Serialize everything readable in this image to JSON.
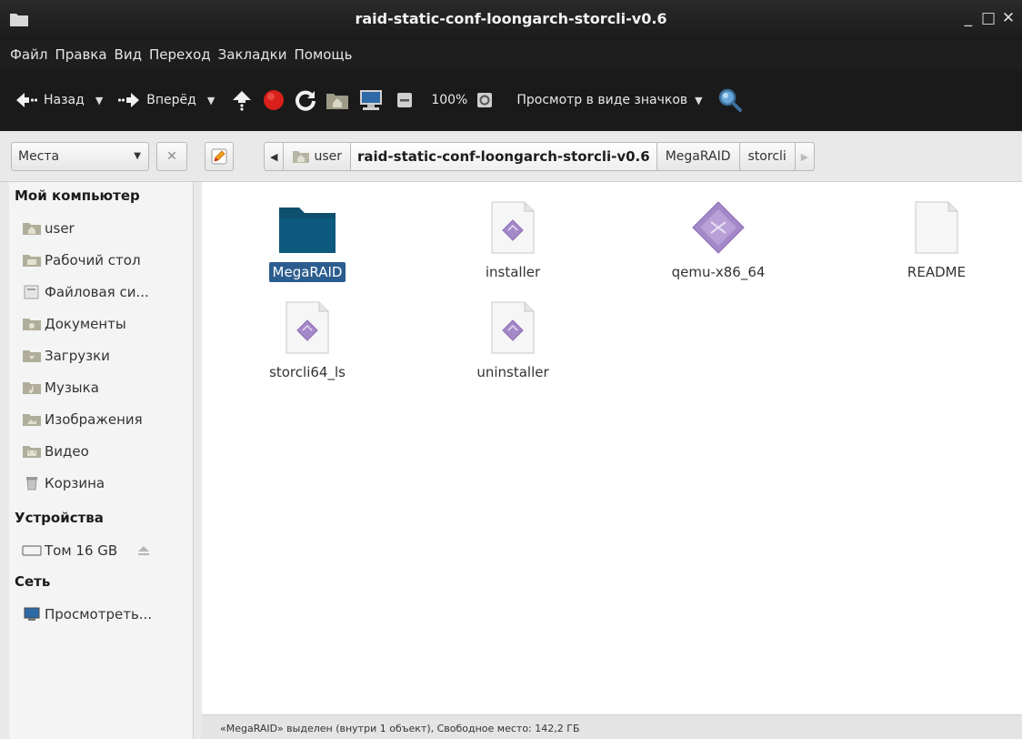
{
  "window": {
    "title": "raid-static-conf-loongarch-storcli-v0.6",
    "controls": {
      "minimize": "_",
      "maximize": "□",
      "close": "✕"
    }
  },
  "menubar": {
    "items": [
      "Файл",
      "Правка",
      "Вид",
      "Переход",
      "Закладки",
      "Помощь"
    ]
  },
  "toolbar": {
    "back_label": "Назад",
    "forward_label": "Вперёд",
    "zoom_level": "100%",
    "view_mode_label": "Просмотр в виде значков",
    "icons": [
      "back-arrow-icon",
      "forward-arrow-icon",
      "up-icon",
      "stop-icon",
      "reload-icon",
      "home-folder-icon",
      "computer-icon",
      "zoom-out-icon",
      "zoom-in-icon",
      "search-icon"
    ]
  },
  "location": {
    "places_label": "Места",
    "breadcrumbs": [
      "user",
      "raid-static-conf-loongarch-storcli-v0.6",
      "MegaRAID",
      "storcli"
    ],
    "current_index": 1
  },
  "sidebar": {
    "sections": [
      {
        "heading": "Мой компьютер",
        "items": [
          "user",
          "Рабочий стол",
          "Файловая си...",
          "Документы",
          "Загрузки",
          "Музыка",
          "Изображения",
          "Видео",
          "Корзина"
        ]
      },
      {
        "heading": "Устройства",
        "items": [
          "Том 16 GB"
        ]
      },
      {
        "heading": "Сеть",
        "items": [
          "Просмотреть..."
        ]
      }
    ]
  },
  "files": [
    {
      "name": "MegaRAID",
      "type": "folder",
      "selected": true
    },
    {
      "name": "installer",
      "type": "executable",
      "selected": false
    },
    {
      "name": "qemu-x86_64",
      "type": "binary",
      "selected": false
    },
    {
      "name": "README",
      "type": "text",
      "selected": false
    },
    {
      "name": "storcli64_ls",
      "type": "executable",
      "selected": false
    },
    {
      "name": "uninstaller",
      "type": "executable",
      "selected": false
    }
  ],
  "statusbar": {
    "text": "«MegaRAID» выделен (внутри 1 объект), Свободное место: 142,2 ГБ"
  },
  "colors": {
    "selection": "#2c5d8f",
    "folder": "#0f4f6e",
    "executable_diamond": "#a489c9",
    "stop": "#d9201a"
  }
}
